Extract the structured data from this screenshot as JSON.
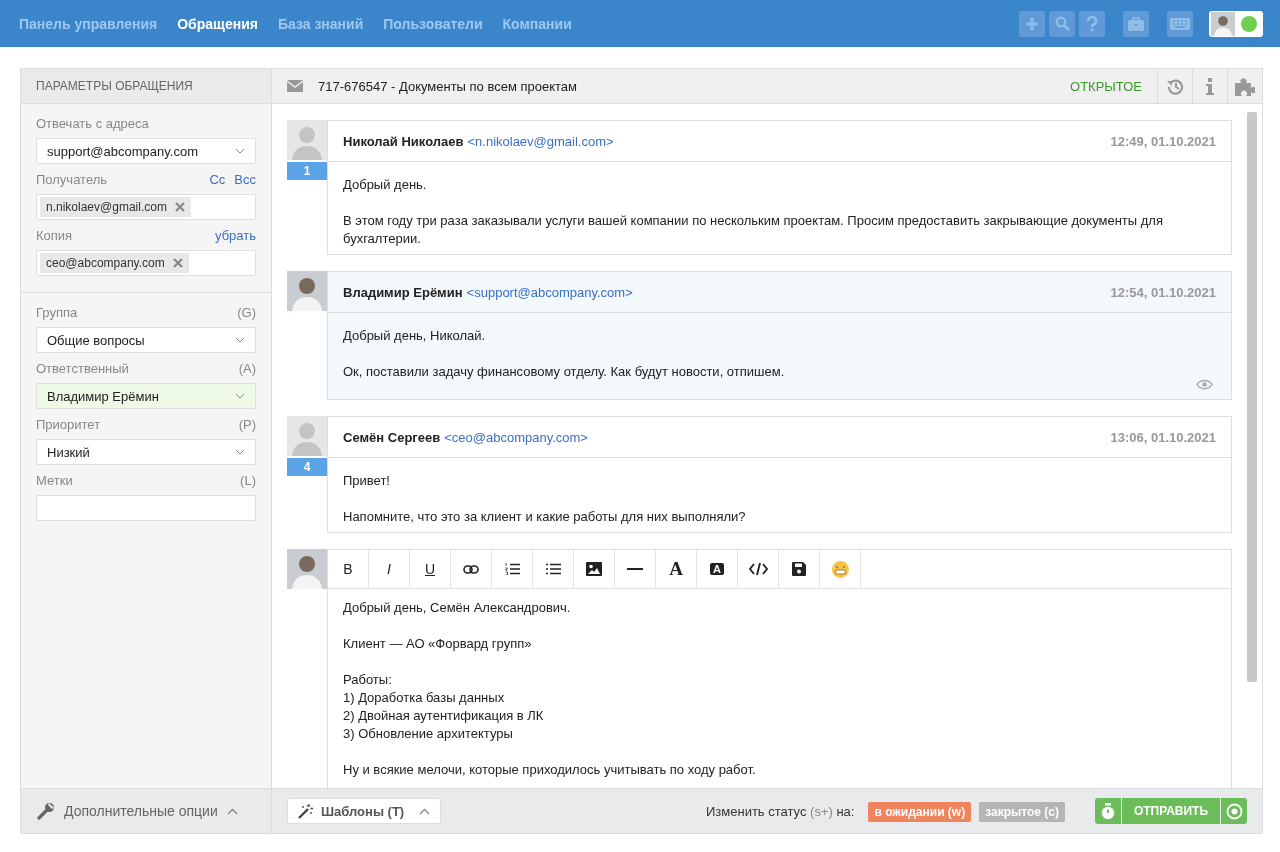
{
  "nav": {
    "items": [
      {
        "label": "Панель управления",
        "selected": false
      },
      {
        "label": "Обращения",
        "selected": true
      },
      {
        "label": "База знаний",
        "selected": false
      },
      {
        "label": "Пользователи",
        "selected": false
      },
      {
        "label": "Компании",
        "selected": false
      }
    ],
    "user": {
      "online": true
    }
  },
  "sidebar": {
    "title": "ПАРАМЕТРЫ ОБРАЩЕНИЯ",
    "sections": [
      [
        {
          "kind": "select",
          "label": "Отвечать с адреса",
          "value": "support@abcompany.com",
          "highlighted": false
        },
        {
          "kind": "tags",
          "label": "Получатель",
          "links": [
            "Cc",
            "Bcc"
          ],
          "tags": [
            "n.nikolaev@gmail.com"
          ]
        },
        {
          "kind": "tags",
          "label": "Копия",
          "links": [
            "убрать"
          ],
          "tags": [
            "ceo@abcompany.com"
          ]
        }
      ],
      [
        {
          "kind": "select",
          "label": "Группа",
          "shortcut": "(G)",
          "value": "Общие вопросы",
          "highlighted": false
        },
        {
          "kind": "select",
          "label": "Ответственный",
          "shortcut": "(A)",
          "value": "Владимир Ерёмин",
          "highlighted": true
        },
        {
          "kind": "select",
          "label": "Приоритет",
          "shortcut": "(P)",
          "value": "Низкий",
          "highlighted": false
        },
        {
          "kind": "text",
          "label": "Метки",
          "shortcut": "(L)"
        }
      ]
    ],
    "footer": "Дополнительные опции"
  },
  "ticket": {
    "title": "717-676547 - Документы по всем проектам",
    "status": "ОТКРЫТОЕ"
  },
  "messages": [
    {
      "author": "Николай Николаев",
      "email": "<n.nikolaev@gmail.com>",
      "time": "12:49, 01.10.2021",
      "number": "1",
      "staff": false,
      "seen": false,
      "paragraphs": [
        "Добрый день.",
        "В этом году три раза заказывали услуги вашей компании по нескольким проектам. Просим предоставить закрывающие документы для бухгалтерии."
      ]
    },
    {
      "author": "Владимир Ерёмин",
      "email": "<support@abcompany.com>",
      "time": "12:54, 01.10.2021",
      "staff": true,
      "seen": true,
      "paragraphs": [
        "Добрый день, Николай.",
        "Ок, поставили задачу финансовому отделу. Как будут новости, отпишем."
      ]
    },
    {
      "author": "Семён Сергеев",
      "email": "<ceo@abcompany.com>",
      "time": "13:06, 01.10.2021",
      "number": "4",
      "staff": false,
      "seen": false,
      "paragraphs": [
        "Привет!",
        "Напомните, что это за клиент и какие работы для них выполняли?"
      ]
    }
  ],
  "editor": {
    "toolbar": [
      {
        "kind": "bold",
        "label": "B"
      },
      {
        "kind": "italic",
        "label": "I"
      },
      {
        "kind": "underline",
        "label": "U"
      },
      {
        "kind": "link"
      },
      {
        "kind": "ordered-list"
      },
      {
        "kind": "bullet-list"
      },
      {
        "kind": "image"
      },
      {
        "kind": "rule"
      },
      {
        "kind": "font",
        "label": "A"
      },
      {
        "kind": "highlight",
        "label": "A"
      },
      {
        "kind": "code"
      },
      {
        "kind": "save"
      },
      {
        "kind": "emoji"
      }
    ],
    "paragraphs": [
      [
        "Добрый день, Семён Александрович."
      ],
      [
        "Клиент — АО «Форвард групп»"
      ],
      [
        "Работы:",
        "1) Доработка базы данных",
        "2) Двойная аутентификация в ЛК",
        "3) Обновление архитектуры"
      ],
      [
        "Ну и всякие мелочи, которые приходилось учитывать по ходу работ."
      ]
    ]
  },
  "footer": {
    "templates": "Шаблоны (T)",
    "status_prompt": "Изменить статус",
    "status_shortcut": "(s+)",
    "status_suffix": "на:",
    "statuses": [
      {
        "label": "в ожидании (w)",
        "color": "#f0845f"
      },
      {
        "label": "закрытое (c)",
        "color": "#b5b5b5"
      }
    ],
    "send": "ОТПРАВИТЬ"
  }
}
